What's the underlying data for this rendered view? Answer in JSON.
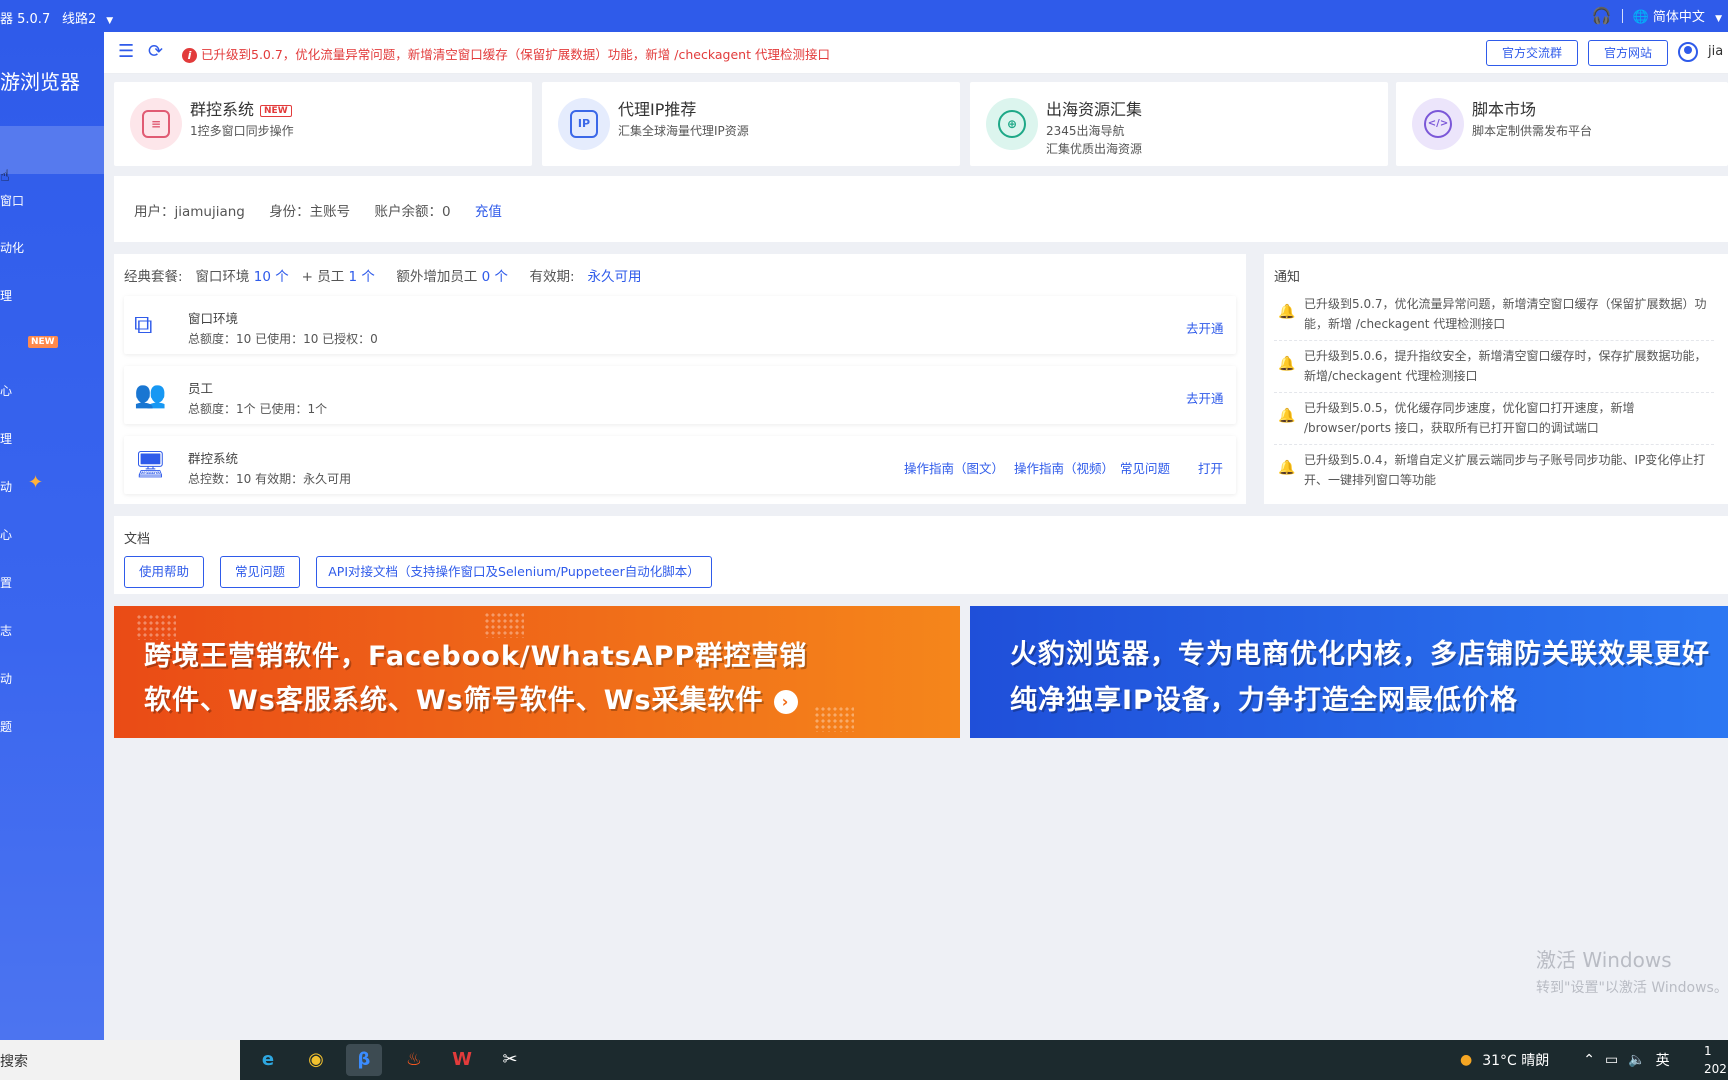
{
  "titlebar": {
    "version": "器 5.0.7",
    "line": "线路2",
    "language": "简体中文"
  },
  "sidebar": {
    "brand": "游浏览器",
    "items": [
      "窗口",
      "动化",
      "理",
      "",
      "心",
      "理",
      "动",
      "心",
      "置",
      "志",
      "动",
      "题"
    ],
    "new_badge": "NEW"
  },
  "topbar": {
    "notice": "已升级到5.0.7，优化流量异常问题，新增清空窗口缓存（保留扩展数据）功能，新增 /checkagent 代理检测接口",
    "btn_group": "官方交流群",
    "btn_site": "官方网站",
    "username_short": "jia"
  },
  "features": [
    {
      "title": "群控系统",
      "badge": "NEW",
      "desc": [
        "1控多窗口同步操作"
      ],
      "icon_text": "≡"
    },
    {
      "title": "代理IP推荐",
      "badge": "",
      "desc": [
        "汇集全球海量代理IP资源"
      ],
      "icon_text": "IP"
    },
    {
      "title": "出海资源汇集",
      "badge": "",
      "desc": [
        "2345出海导航",
        "汇集优质出海资源"
      ],
      "icon_text": "⊕"
    },
    {
      "title": "脚本市场",
      "badge": "",
      "desc": [
        "脚本定制供需发布平台"
      ],
      "icon_text": "</>"
    }
  ],
  "user": {
    "user": "用户：jiamujiang",
    "role": "身份：主账号",
    "balance": "账户余额：0",
    "recharge": "充值"
  },
  "package": {
    "label": "经典套餐:",
    "env_label": "窗口环境",
    "env_count": "10 个",
    "plus_staff": "+ 员工",
    "staff_count": "1 个",
    "extra_label": "额外增加员工",
    "extra_count": "0 个",
    "validity_label": "有效期:",
    "validity": "永久可用",
    "rows": [
      {
        "name": "窗口环境",
        "meta": "总额度：10   已使用：10   已授权：0",
        "link": "去开通"
      },
      {
        "name": "员工",
        "meta": "总额度：1个   已使用：1个",
        "link": "去开通"
      },
      {
        "name": "群控系统",
        "meta": "总控数：10   有效期：永久可用",
        "links": [
          "操作指南（图文）",
          "操作指南（视频）",
          "常见问题",
          "打开"
        ]
      }
    ]
  },
  "notify": {
    "title": "通知",
    "items": [
      "已升级到5.0.7，优化流量异常问题，新增清空窗口缓存（保留扩展数据）功能，新增 /checkagent 代理检测接口",
      "已升级到5.0.6，提升指纹安全，新增清空窗口缓存时，保存扩展数据功能，新增/checkagent 代理检测接口",
      "已升级到5.0.5，优化缓存同步速度，优化窗口打开速度，新增 /browser/ports 接口，获取所有已打开窗口的调试端口",
      "已升级到5.0.4，新增自定义扩展云端同步与子账号同步功能、IP变化停止打开、一键排列窗口等功能"
    ]
  },
  "docs": {
    "title": "文档",
    "buttons": [
      "使用帮助",
      "常见问题",
      "API对接文档（支持操作窗口及Selenium/Puppeteer自动化脚本）"
    ]
  },
  "banners": [
    {
      "line1": "跨境王营销软件，Facebook/WhatsAPP群控营销",
      "line2": "软件、Ws客服系统、Ws筛号软件、Ws采集软件",
      "color": "#f26a1b"
    },
    {
      "line1": "火豹浏览器，专为电商优化内核，多店铺防关联效果更好",
      "line2": "纯净独享IP设备，力争打造全网最低价格",
      "color": "#1f5ce6"
    }
  ],
  "watermark": {
    "line1": "激活 Windows",
    "line2": "转到\"设置\"以激活 Windows。"
  },
  "taskbar": {
    "search": "搜索",
    "weather": "31°C  晴朗",
    "ime": "英",
    "clock1": "1",
    "clock2": "202"
  }
}
